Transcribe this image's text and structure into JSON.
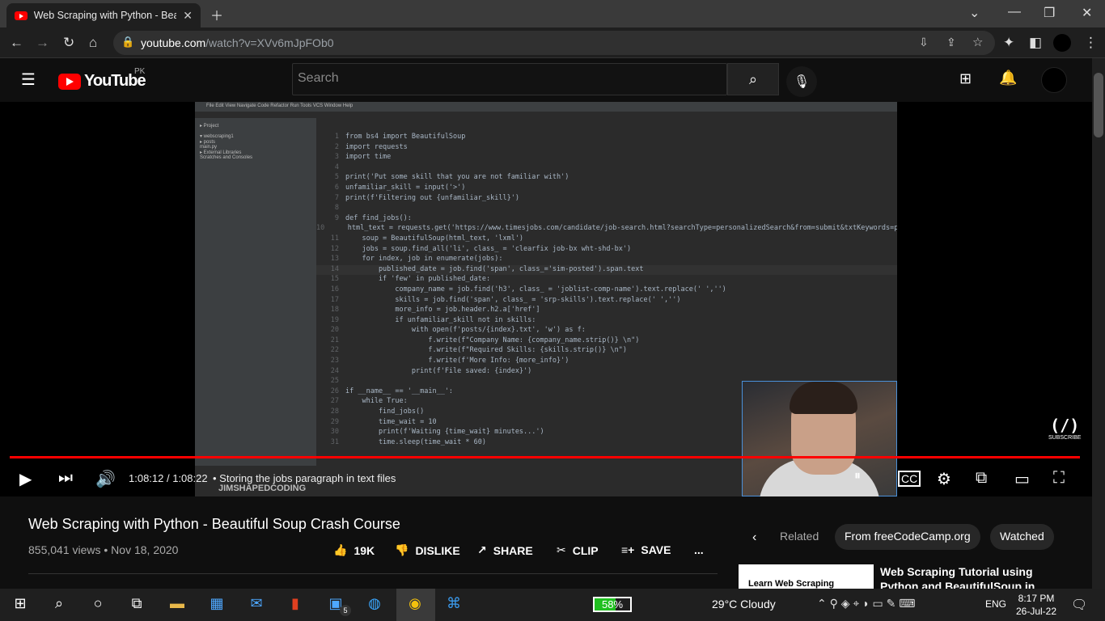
{
  "browser": {
    "tab_title": "Web Scraping with Python - Beau",
    "url_host": "youtube.com",
    "url_path": "/watch?v=XVv6mJpFOb0"
  },
  "youtube": {
    "logo": "YouTube",
    "region": "PK",
    "search_placeholder": "Search"
  },
  "player": {
    "time": "1:08:12 / 1:08:22",
    "chapter": "• Storing the jobs paragraph in text files",
    "progress": 0.998,
    "watermark": "JIMSHAPEDCODING",
    "subscribe": "SUBSCRIBE",
    "channel_mark": "(/)"
  },
  "code": {
    "lines": [
      [
        "1",
        "from bs4 import BeautifulSoup"
      ],
      [
        "2",
        "import requests"
      ],
      [
        "3",
        "import time"
      ],
      [
        "4",
        ""
      ],
      [
        "5",
        "print('Put some skill that you are not familiar with')"
      ],
      [
        "6",
        "unfamiliar_skill = input('>')"
      ],
      [
        "7",
        "print(f'Filtering out {unfamiliar_skill}')"
      ],
      [
        "8",
        ""
      ],
      [
        "9",
        "def find_jobs():"
      ],
      [
        "10",
        "    html_text = requests.get('https://www.timesjobs.com/candidate/job-search.html?searchType=personalizedSearch&from=submit&txtKeywords=p"
      ],
      [
        "11",
        "    soup = BeautifulSoup(html_text, 'lxml')"
      ],
      [
        "12",
        "    jobs = soup.find_all('li', class_ = 'clearfix job-bx wht-shd-bx')"
      ],
      [
        "13",
        "    for index, job in enumerate(jobs):"
      ],
      [
        "14",
        "        published_date = job.find('span', class_='sim-posted').span.text"
      ],
      [
        "15",
        "        if 'few' in published_date:"
      ],
      [
        "16",
        "            company_name = job.find('h3', class_ = 'joblist-comp-name').text.replace(' ','')"
      ],
      [
        "17",
        "            skills = job.find('span', class_ = 'srp-skills').text.replace(' ','')"
      ],
      [
        "18",
        "            more_info = job.header.h2.a['href']"
      ],
      [
        "19",
        "            if unfamiliar_skill not in skills:"
      ],
      [
        "20",
        "                with open(f'posts/{index}.txt', 'w') as f:"
      ],
      [
        "21",
        "                    f.write(f\"Company Name: {company_name.strip()} \\n\")"
      ],
      [
        "22",
        "                    f.write(f\"Required Skills: {skills.strip()} \\n\")"
      ],
      [
        "23",
        "                    f.write(f'More Info: {more_info}')"
      ],
      [
        "24",
        "                print(f'File saved: {index}')"
      ],
      [
        "25",
        ""
      ],
      [
        "26",
        "if __name__ == '__main__':"
      ],
      [
        "27",
        "    while True:"
      ],
      [
        "28",
        "        find_jobs()"
      ],
      [
        "29",
        "        time_wait = 10"
      ],
      [
        "30",
        "        print(f'Waiting {time_wait} minutes...')"
      ],
      [
        "31",
        "        time.sleep(time_wait * 60)"
      ]
    ]
  },
  "video": {
    "title": "Web Scraping with Python - Beautiful Soup Crash Course",
    "views": "855,041 views • Nov 18, 2020",
    "likes": "19K",
    "dislike": "DISLIKE",
    "share": "SHARE",
    "clip": "CLIP",
    "save": "SAVE",
    "more": "..."
  },
  "chips": [
    "Related",
    "From freeCodeCamp.org",
    "Watched"
  ],
  "recommended": {
    "thumb_text": "Learn Web Scraping",
    "title": "Web Scraping Tutorial using Python and BeautifulSoup in"
  },
  "taskbar": {
    "battery": "58%",
    "battery_level": 0.58,
    "weather": "29°C  Cloudy",
    "lang": "ENG",
    "time": "8:17 PM",
    "date": "26-Jul-22",
    "badge": "5"
  }
}
